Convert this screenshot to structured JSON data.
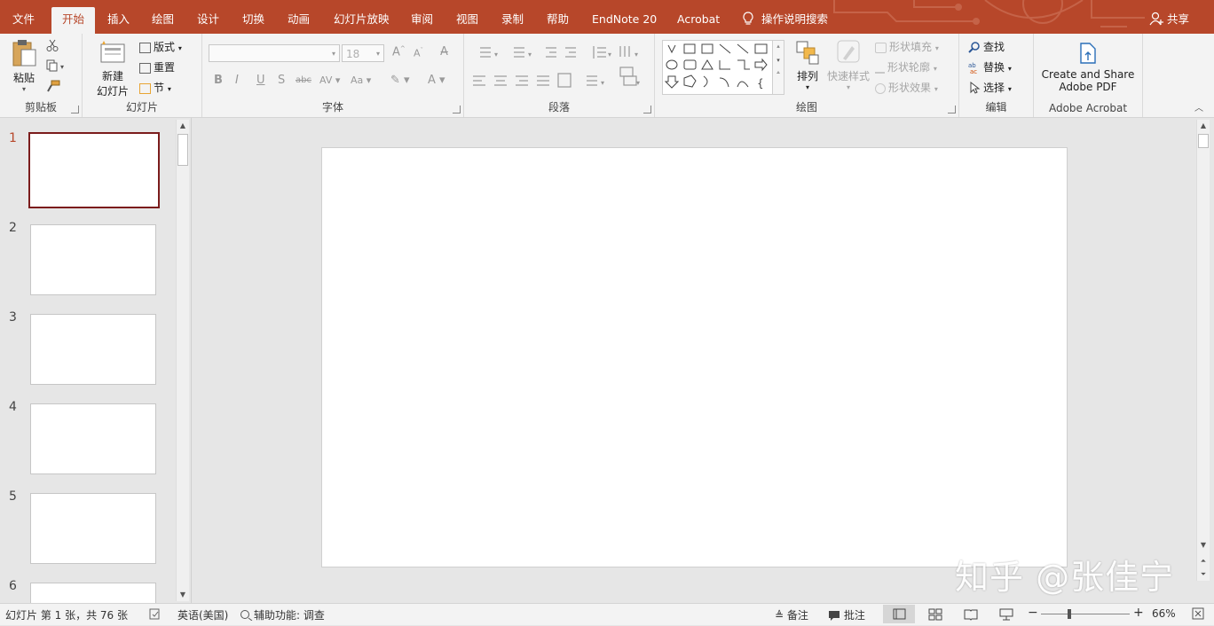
{
  "tabs": [
    {
      "label": "文件"
    },
    {
      "label": "开始"
    },
    {
      "label": "插入"
    },
    {
      "label": "绘图"
    },
    {
      "label": "设计"
    },
    {
      "label": "切换"
    },
    {
      "label": "动画"
    },
    {
      "label": "幻灯片放映"
    },
    {
      "label": "审阅"
    },
    {
      "label": "视图"
    },
    {
      "label": "录制"
    },
    {
      "label": "帮助"
    },
    {
      "label": "EndNote 20"
    },
    {
      "label": "Acrobat"
    }
  ],
  "tell_me": "操作说明搜索",
  "share": "共享",
  "ribbon": {
    "clipboard": {
      "paste": "粘贴",
      "label": "剪贴板"
    },
    "slides": {
      "new_line1": "新建",
      "new_line2": "幻灯片",
      "layout": "版式",
      "reset": "重置",
      "section": "节",
      "label": "幻灯片"
    },
    "font": {
      "size": "18",
      "label": "字体"
    },
    "paragraph": {
      "label": "段落"
    },
    "drawing": {
      "arrange": "排列",
      "quick_styles": "快速样式",
      "fill": "形状填充",
      "outline": "形状轮廓",
      "effects": "形状效果",
      "label": "绘图"
    },
    "editing": {
      "find": "查找",
      "replace": "替换",
      "select": "选择",
      "label": "编辑"
    },
    "acrobat": {
      "line1": "Create and Share",
      "line2": "Adobe PDF",
      "label": "Adobe Acrobat"
    }
  },
  "slides": [
    {
      "number": "1"
    },
    {
      "number": "2"
    },
    {
      "number": "3"
    },
    {
      "number": "4"
    },
    {
      "number": "5"
    },
    {
      "number": "6"
    }
  ],
  "watermark": "知乎 @张佳宁",
  "status": {
    "slide_info": "幻灯片 第 1 张，共 76 张",
    "language": "英语(美国)",
    "accessibility": "辅助功能: 调查",
    "notes": "备注",
    "comments": "批注",
    "zoom": "66%"
  },
  "colors": {
    "accent": "#b7472a",
    "selected_thumb_border": "#7b1c1c"
  }
}
